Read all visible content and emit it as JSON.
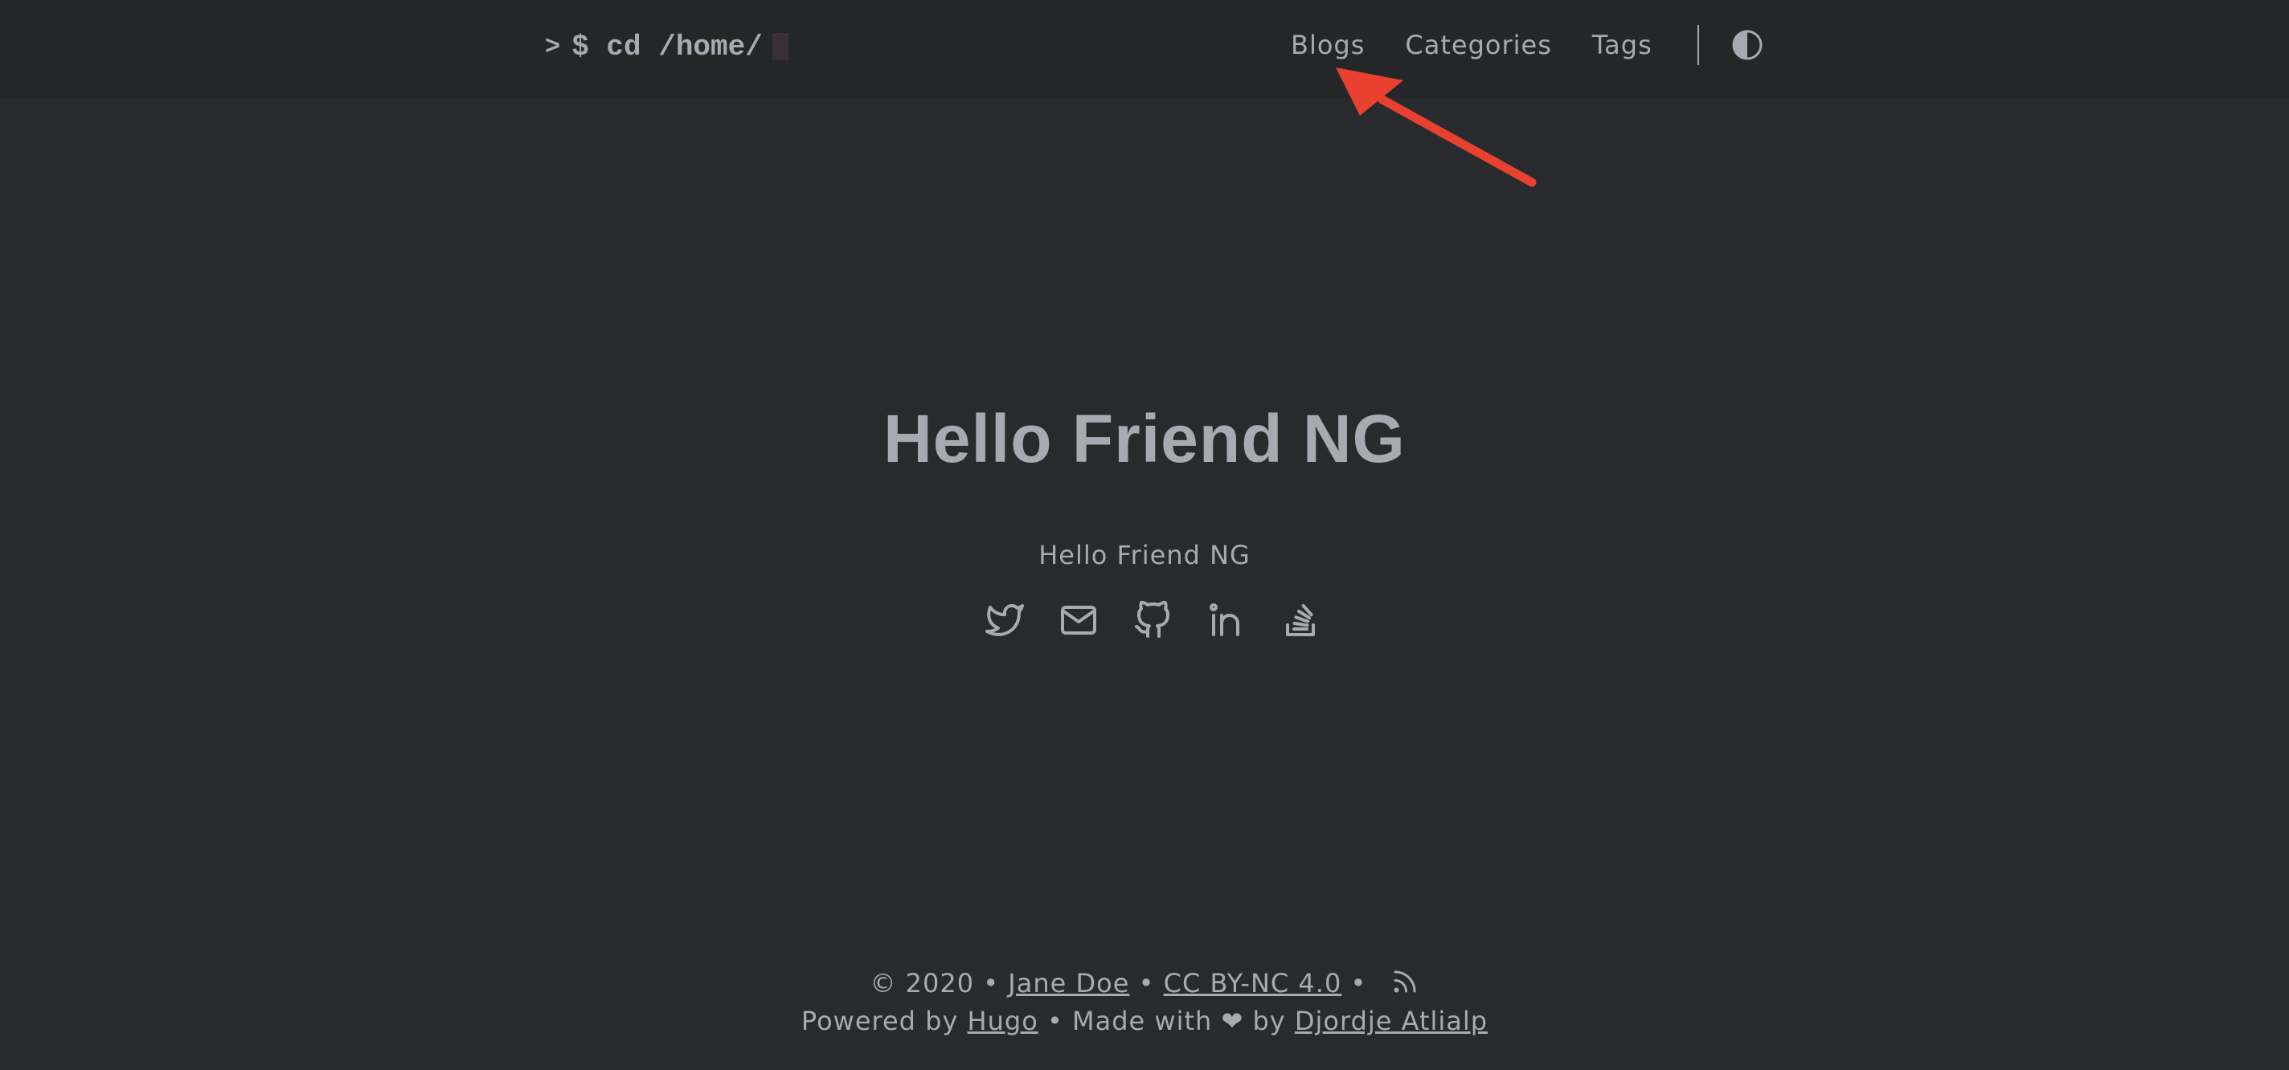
{
  "header": {
    "logo_prompt": ">",
    "logo_text": "$ cd /home/",
    "nav": [
      {
        "label": "Blogs"
      },
      {
        "label": "Categories"
      },
      {
        "label": "Tags"
      }
    ],
    "theme_toggle_icon": "contrast-icon"
  },
  "main": {
    "title": "Hello Friend NG",
    "subtitle": "Hello Friend NG",
    "social_icons": [
      "twitter-icon",
      "mail-icon",
      "github-icon",
      "linkedin-icon",
      "stackoverflow-icon"
    ]
  },
  "footer": {
    "copyright": "© 2020 •",
    "author": "Jane Doe",
    "sep1": "•",
    "license": "CC BY-NC 4.0",
    "sep2": "•",
    "rss_icon": "rss-icon",
    "powered_by": "Powered by",
    "hugo": "Hugo",
    "made_with": "•  Made with ❤ by",
    "theme_author": "Djordje Atlialp"
  },
  "annotation": {
    "arrow_color": "#e8412f"
  }
}
